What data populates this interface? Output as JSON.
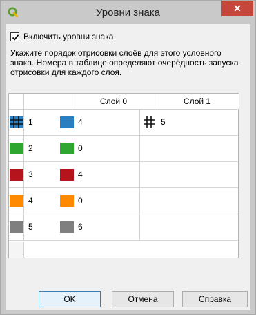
{
  "window": {
    "title": "Уровни знака",
    "close_symbol": "✕",
    "icon": "qgis-logo-icon"
  },
  "enable_checkbox": {
    "checked": true,
    "label": "Включить уровни знака"
  },
  "description": "Укажите порядок отрисовки слоёв для этого условного знака. Номера в таблице определяют очерёдность запуска отрисовки для каждого слоя.",
  "table": {
    "columns": [
      "Слой 0",
      "Слой 1"
    ],
    "rows": [
      {
        "label": "1",
        "symbol_color": "#2a7fc1",
        "symbol_style": "grid",
        "layer0": {
          "color": "#2a7fc1",
          "value": "4"
        },
        "layer1": {
          "icon": "grid-icon",
          "value": "5"
        }
      },
      {
        "label": "2",
        "symbol_color": "#2fa62f",
        "layer0": {
          "color": "#2fa62f",
          "value": "0"
        },
        "layer1": null
      },
      {
        "label": "3",
        "symbol_color": "#b5141c",
        "layer0": {
          "color": "#b5141c",
          "value": "4"
        },
        "layer1": null
      },
      {
        "label": "4",
        "symbol_color": "#ff8a00",
        "layer0": {
          "color": "#ff8a00",
          "value": "0"
        },
        "layer1": null
      },
      {
        "label": "5",
        "symbol_color": "#7f7f7f",
        "layer0": {
          "color": "#7f7f7f",
          "value": "6"
        },
        "layer1": null
      }
    ]
  },
  "buttons": {
    "ok": "OK",
    "cancel": "Отмена",
    "help": "Справка"
  }
}
